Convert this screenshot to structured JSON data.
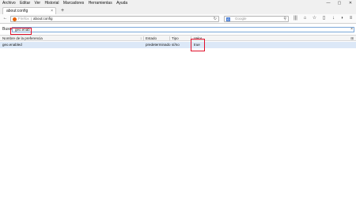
{
  "menu": [
    "Archivo",
    "Editar",
    "Ver",
    "Historial",
    "Marcadores",
    "Herramientas",
    "Ayuda"
  ],
  "window_controls": {
    "minimize": "—",
    "maximize": "▢",
    "close": "✕"
  },
  "tab": {
    "title": "about:config",
    "close": "×"
  },
  "newtab": "+",
  "nav": {
    "back": "←",
    "brand": "Firefox",
    "url": "about:config",
    "reload": "↻",
    "search_placeholder": "Google",
    "search_engine": "G",
    "lens": "⚲",
    "toolbar": {
      "bookmark": "☆",
      "library": "|||",
      "sidebar": "▯",
      "download": "↓",
      "home": "⌂",
      "pocket": "◗",
      "menu": "≡"
    }
  },
  "filter": {
    "label": "Buscar:",
    "value": "geo.enab",
    "clear": "×"
  },
  "columns": {
    "name": "Nombre de la preferencia",
    "state": "Estado",
    "type": "Tipo",
    "value": "Valor"
  },
  "rows": [
    {
      "name": "geo.enabled",
      "state": "predeterminado",
      "type": "sí/no",
      "value": "true"
    }
  ],
  "colors": {
    "highlight": "#e0102a",
    "selected_row": "#dce8f7",
    "firefox": "#e66000"
  }
}
